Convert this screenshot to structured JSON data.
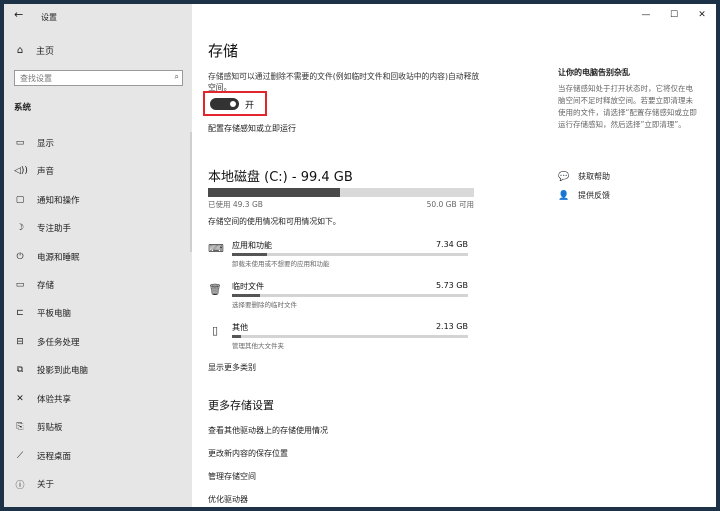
{
  "window": {
    "title": "设置",
    "back_icon": "←",
    "controls": {
      "minimize": "—",
      "maximize": "☐",
      "close": "✕"
    }
  },
  "sidebar": {
    "home": {
      "icon": "⌂",
      "label": "主页"
    },
    "search": {
      "placeholder": "查找设置",
      "icon": "⌕"
    },
    "section": "系统",
    "items": [
      {
        "icon": "▭",
        "label": "显示"
      },
      {
        "icon": "◁))",
        "label": "声音"
      },
      {
        "icon": "▢",
        "label": "通知和操作"
      },
      {
        "icon": "☽",
        "label": "专注助手"
      },
      {
        "icon": "⏻",
        "label": "电源和睡眠"
      },
      {
        "icon": "▭",
        "label": "存储"
      },
      {
        "icon": "⊏",
        "label": "平板电脑"
      },
      {
        "icon": "⊟",
        "label": "多任务处理"
      },
      {
        "icon": "⧉",
        "label": "投影到此电脑"
      },
      {
        "icon": "✕",
        "label": "体验共享"
      },
      {
        "icon": "⎘",
        "label": "剪贴板"
      },
      {
        "icon": "⟋",
        "label": "远程桌面"
      },
      {
        "icon": "ⓘ",
        "label": "关于"
      }
    ]
  },
  "main": {
    "title": "存储",
    "sense_desc": "存储感知可以通过删除不需要的文件(例如临时文件和回收站中的内容)自动释放空间。",
    "toggle": {
      "label": "开",
      "on": true
    },
    "configure_link": "配置存储感知或立即运行",
    "disk": {
      "title": "本地磁盘 (C:) - 99.4 GB",
      "used_label": "已使用 49.3 GB",
      "free_label": "50.0 GB 可用",
      "used_fraction": 0.496
    },
    "usage_desc": "存储空间的使用情况和可用情况如下。",
    "categories": [
      {
        "icon": "⌨",
        "name": "应用和功能",
        "size": "7.34 GB",
        "sub": "卸载未使用或不想要的应用和功能",
        "fraction": 0.15
      },
      {
        "icon": "🗑",
        "name": "临时文件",
        "size": "5.73 GB",
        "sub": "选择要删除的临时文件",
        "fraction": 0.12
      },
      {
        "icon": "▯",
        "name": "其他",
        "size": "2.13 GB",
        "sub": "管理其他大文件夹",
        "fraction": 0.04
      }
    ],
    "show_more": "显示更多类别",
    "more_title": "更多存储设置",
    "more_links": [
      "查看其他驱动器上的存储使用情况",
      "更改新内容的保存位置",
      "管理存储空间",
      "优化驱动器"
    ]
  },
  "right": {
    "title": "让你的电脑告别杂乱",
    "desc": "当存储感知处于打开状态时，它将仅在电脑空间不足时释放空间。若要立即清理未使用的文件，请选择“配置存储感知或立即运行存储感知，然后选择”立即清理”。",
    "help": {
      "icon": "💬",
      "label": "获取帮助"
    },
    "feedback": {
      "icon": "👤",
      "label": "提供反馈"
    }
  }
}
